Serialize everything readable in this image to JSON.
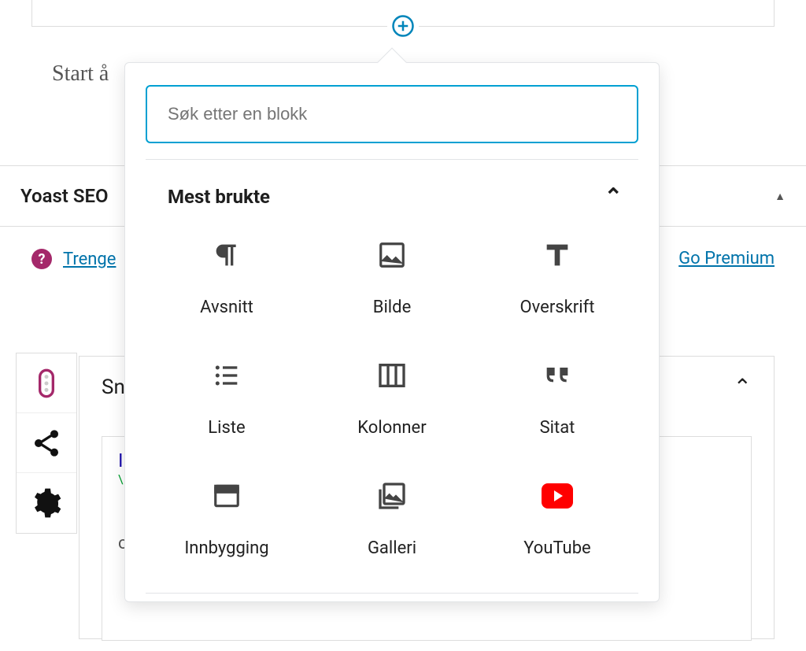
{
  "editor": {
    "prompt_visible_text": "Start å"
  },
  "block_inserter": {
    "search_placeholder": "Søk etter en blokk",
    "section_title": "Mest brukte",
    "blocks": [
      {
        "id": "paragraph",
        "label": "Avsnitt"
      },
      {
        "id": "image",
        "label": "Bilde"
      },
      {
        "id": "heading",
        "label": "Overskrift"
      },
      {
        "id": "list",
        "label": "Liste"
      },
      {
        "id": "columns",
        "label": "Kolonner"
      },
      {
        "id": "quote",
        "label": "Sitat"
      },
      {
        "id": "embed",
        "label": "Innbygging"
      },
      {
        "id": "gallery",
        "label": "Galleri"
      },
      {
        "id": "youtube",
        "label": "YouTube"
      }
    ]
  },
  "yoast": {
    "panel_title": "Yoast SEO",
    "help_link_visible_text": "Trenge",
    "premium_link": "Go Premium",
    "snippet_title_visible_text": "Sn",
    "description_visible_text": "or."
  }
}
